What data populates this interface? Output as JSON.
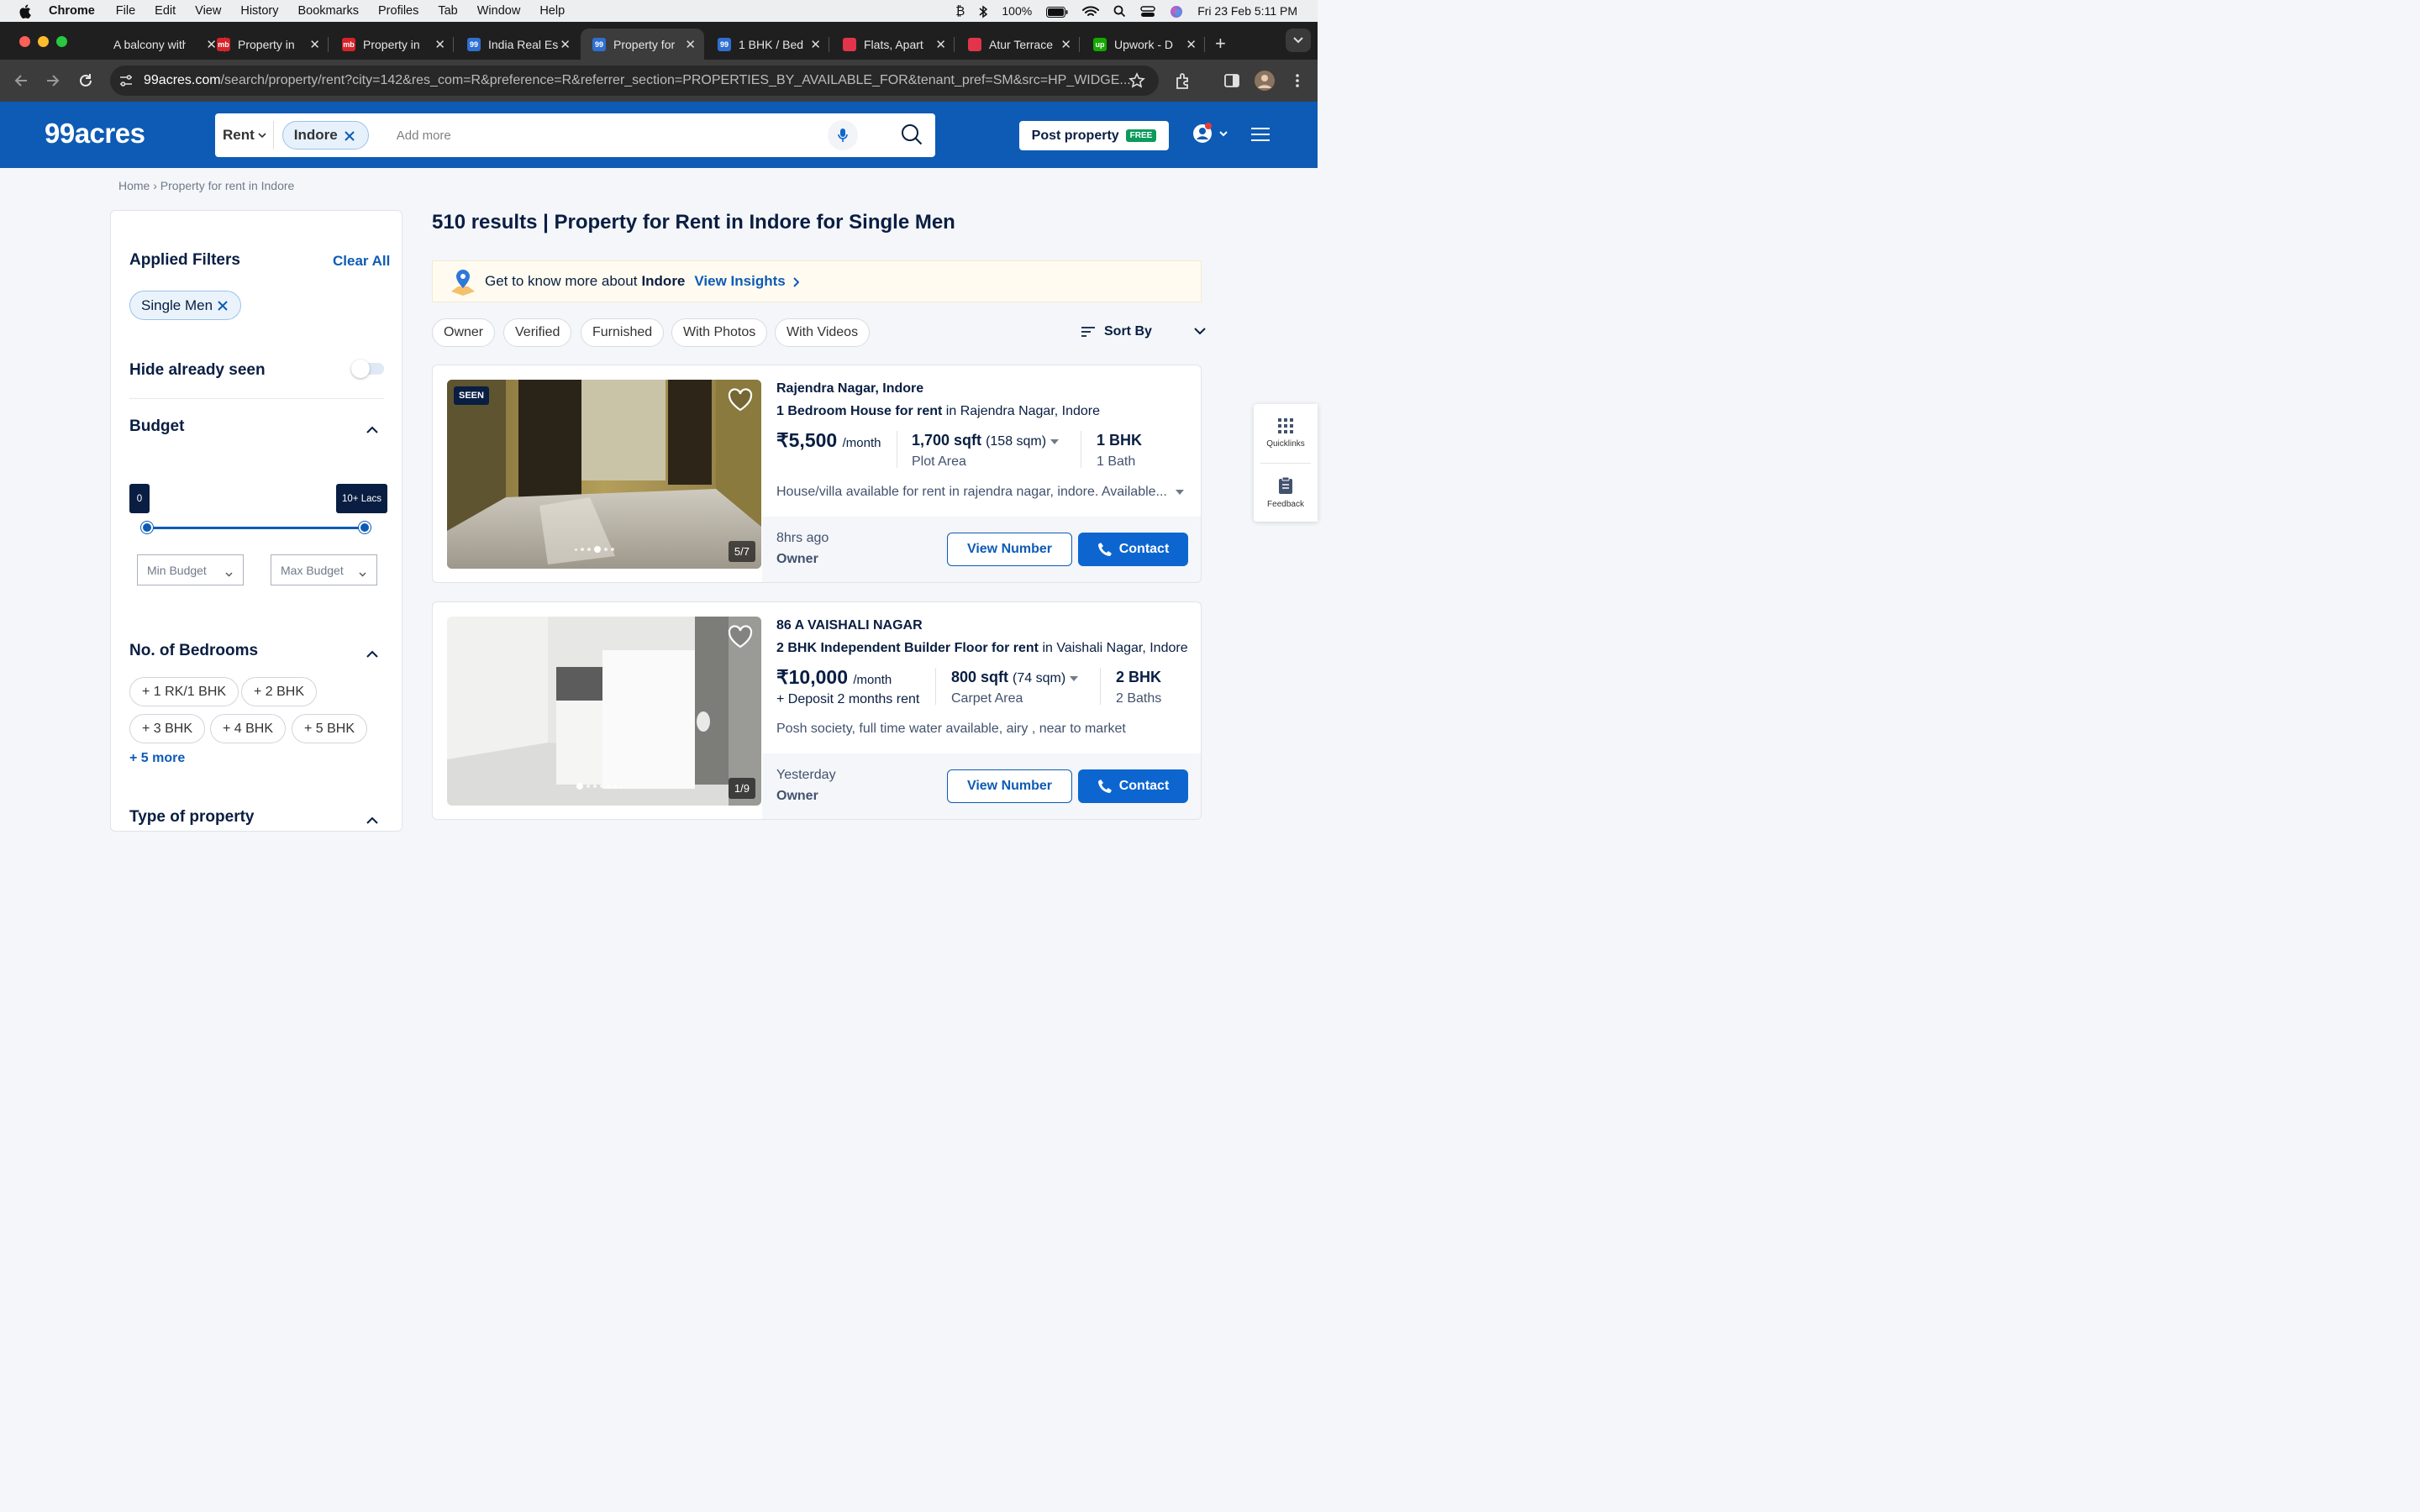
{
  "mac_menu": {
    "items": [
      "Chrome",
      "File",
      "Edit",
      "View",
      "History",
      "Bookmarks",
      "Profiles",
      "Tab",
      "Window",
      "Help"
    ],
    "battery": "100%",
    "datetime": "Fri 23 Feb  5:11 PM"
  },
  "tabs": [
    {
      "title": "A balcony with",
      "favicon": "",
      "fav_color": "#1f1f1f"
    },
    {
      "title": "Property in",
      "favicon": "mb",
      "fav_color": "#d8232a"
    },
    {
      "title": "Property in",
      "favicon": "mb",
      "fav_color": "#d8232a"
    },
    {
      "title": "India Real Es",
      "favicon": "99",
      "fav_color": "#2f6fd1"
    },
    {
      "title": "Property for",
      "favicon": "99",
      "fav_color": "#2f6fd1"
    },
    {
      "title": "1 BHK / Bed",
      "favicon": "99",
      "fav_color": "#2f6fd1"
    },
    {
      "title": "Flats, Apart",
      "favicon": "",
      "fav_color": "#e2344b"
    },
    {
      "title": "Atur Terrace",
      "favicon": "",
      "fav_color": "#e2344b"
    },
    {
      "title": "Upwork - D",
      "favicon": "up",
      "fav_color": "#14a800"
    }
  ],
  "address": {
    "host": "99acres.com",
    "path": "/search/property/rent?city=142&res_com=R&preference=R&referrer_section=PROPERTIES_BY_AVAILABLE_FOR&tenant_pref=SM&src=HP_WIDGE..."
  },
  "header": {
    "logo": "99acres",
    "rent_label": "Rent",
    "city_chip": "Indore",
    "add_more_placeholder": "Add more",
    "post_property": "Post property",
    "free_badge": "FREE"
  },
  "breadcrumb": "Home › Property for rent in Indore",
  "filters": {
    "applied_title": "Applied Filters",
    "clear_all": "Clear All",
    "applied_chip": "Single Men",
    "hide_seen": "Hide already seen",
    "hide_seen_on": false,
    "budget_title": "Budget",
    "budget_min_tip": "0",
    "budget_max_tip": "10+ Lacs",
    "min_budget": "Min Budget",
    "max_budget": "Max Budget",
    "bedrooms_title": "No. of Bedrooms",
    "bedrooms": [
      "+ 1 RK/1 BHK",
      "+ 2 BHK",
      "+ 3 BHK",
      "+ 4 BHK",
      "+ 5 BHK"
    ],
    "bedrooms_more": "+ 5 more",
    "type_title": "Type of property"
  },
  "results": {
    "title": "510 results | Property for Rent in Indore for Single Men",
    "insight_text": "Get to know more about ",
    "insight_city": "Indore",
    "insight_link": "View Insights",
    "quick_filters": [
      "Owner",
      "Verified",
      "Furnished",
      "With Photos",
      "With Videos"
    ],
    "sort_label": "Sort By"
  },
  "listings": [
    {
      "location": "Rajendra Nagar, Indore",
      "title_bold": "1 Bedroom House for rent",
      "title_rest": " in Rajendra Nagar, Indore",
      "price": "₹5,500",
      "per": "/month",
      "deposit": "",
      "area": "1,700 sqft",
      "area_alt": "(158 sqm)",
      "area_type": "Plot Area",
      "config": "1 BHK",
      "baths": "1 Bath",
      "description": "House/villa available for rent in rajendra nagar, indore. Available...",
      "posted": "8hrs ago",
      "posted_by": "Owner",
      "seen_badge": "SEEN",
      "photo_counter": "5/7",
      "view_number": "View Number",
      "contact": "Contact"
    },
    {
      "location": "86 A VAISHALI NAGAR",
      "title_bold": "2 BHK Independent Builder Floor for rent",
      "title_rest": " in Vaishali Nagar, Indore",
      "price": "₹10,000",
      "per": "/month",
      "deposit": "+ Deposit 2 months rent",
      "area": "800 sqft",
      "area_alt": "(74 sqm)",
      "area_type": "Carpet Area",
      "config": "2 BHK",
      "baths": "2 Baths",
      "description": "Posh society, full time water available, airy , near to market",
      "posted": "Yesterday",
      "posted_by": "Owner",
      "seen_badge": "",
      "photo_counter": "1/9",
      "view_number": "View Number",
      "contact": "Contact"
    }
  ],
  "side_widget": {
    "quicklinks": "Quicklinks",
    "feedback": "Feedback"
  }
}
